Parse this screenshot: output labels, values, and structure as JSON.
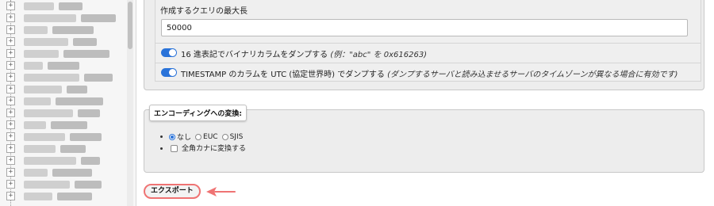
{
  "options": {
    "max_length_label": "作成するクエリの最大長",
    "max_length_value": "50000",
    "hex_binary": {
      "label": "16 進表記でバイナリカラムをダンプする ",
      "hint": "(例：\"abc\" を 0x616263)",
      "enabled": true
    },
    "timestamp_utc": {
      "label": "TIMESTAMP のカラムを UTC (協定世界時) でダンプする ",
      "hint": "(ダンプするサーバと読み込ませるサーバのタイムゾーンが異なる場合に有効です)",
      "enabled": true
    }
  },
  "encoding": {
    "legend": "エンコーディングへの変換:",
    "options": [
      "なし",
      "EUC",
      "SJIS"
    ],
    "selected": "なし",
    "kana_label": "全角カナに変換する",
    "kana_checked": false
  },
  "export_button": "エクスポート",
  "colors": {
    "toggle_on": "#2a73d9",
    "highlight": "#ef7373"
  },
  "icons": [
    "tree-expander-icon",
    "arrow-pointer-icon"
  ]
}
